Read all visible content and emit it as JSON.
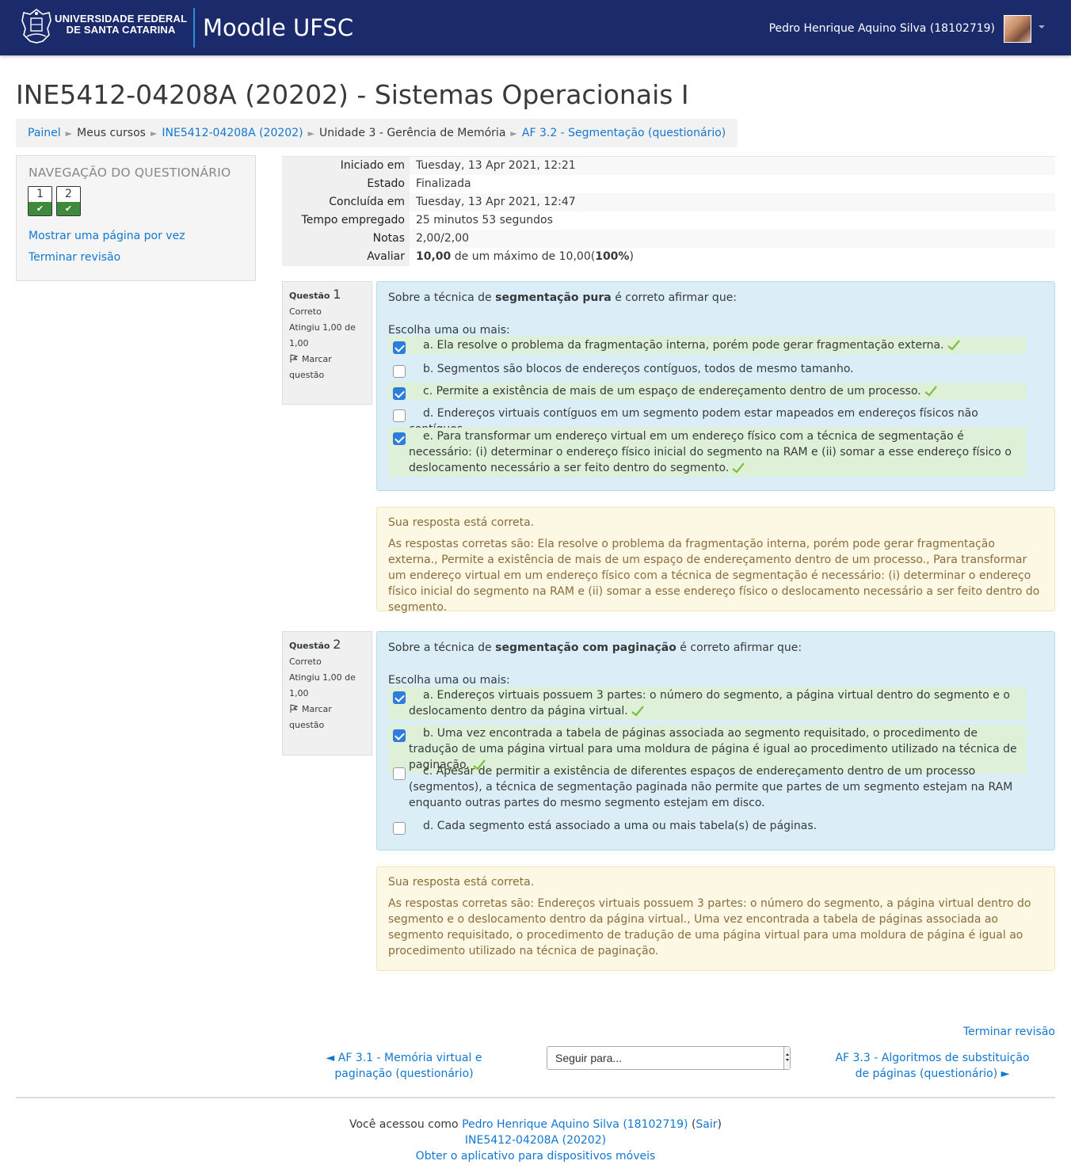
{
  "header": {
    "university_line1": "UNIVERSIDADE FEDERAL",
    "university_line2": "DE SANTA CATARINA",
    "site_name": "Moodle UFSC",
    "user_name": "Pedro Henrique Aquino Silva (18102719)"
  },
  "page": {
    "title": "INE5412-04208A (20202) - Sistemas Operacionais I"
  },
  "breadcrumb": [
    {
      "label": "Painel",
      "link": true
    },
    {
      "label": "Meus cursos",
      "link": false
    },
    {
      "label": "INE5412-04208A (20202)",
      "link": true
    },
    {
      "label": "Unidade 3 - Gerência de Memória",
      "link": false
    },
    {
      "label": "AF 3.2 - Segmentação (questionário)",
      "link": true
    }
  ],
  "quiz_nav": {
    "title": "NAVEGAÇÃO DO QUESTIONÁRIO",
    "buttons": [
      {
        "number": "1",
        "state": "correct"
      },
      {
        "number": "2",
        "state": "correct"
      }
    ],
    "show_one_page": "Mostrar uma página por vez",
    "finish_review": "Terminar revisão"
  },
  "summary": [
    {
      "label": "Iniciado em",
      "value": "Tuesday, 13 Apr 2021, 12:21"
    },
    {
      "label": "Estado",
      "value": "Finalizada"
    },
    {
      "label": "Concluída em",
      "value": "Tuesday, 13 Apr 2021, 12:47"
    },
    {
      "label": "Tempo empregado",
      "value": "25 minutos 53 segundos"
    },
    {
      "label": "Notas",
      "value": "2,00/2,00"
    },
    {
      "label": "Avaliar",
      "value_bold1": "10,00",
      "value_mid": " de um máximo de 10,00(",
      "value_bold2": "100%",
      "value_end": ")"
    }
  ],
  "questions": [
    {
      "label": "Questão",
      "number": "1",
      "status": "Correto",
      "grade": "Atingiu 1,00 de 1,00",
      "flag": "Marcar questão",
      "text_before": "Sobre a técnica de ",
      "text_bold": "segmentação pura",
      "text_after": " é correto afirmar que:",
      "prompt": "Escolha uma ou mais:",
      "options": [
        {
          "letter": "a.",
          "text": "Ela resolve o problema da fragmentação interna, porém pode gerar fragmentação externa.",
          "checked": true,
          "correct": true
        },
        {
          "letter": "b.",
          "text": "Segmentos são blocos de endereços contíguos, todos de mesmo tamanho.",
          "checked": false,
          "correct": false
        },
        {
          "letter": "c.",
          "text": "Permite a existência de mais de um espaço de endereçamento dentro de um processo.",
          "checked": true,
          "correct": true
        },
        {
          "letter": "d.",
          "text": "Endereços virtuais contíguos em um segmento podem estar mapeados em endereços físicos não contíguos.",
          "checked": false,
          "correct": false
        },
        {
          "letter": "e.",
          "text": "Para transformar um endereço virtual em um endereço físico com a técnica de segmentação é necessário: (i) determinar o endereço físico inicial do segmento na RAM e (ii) somar a esse endereço físico o deslocamento necessário a ser feito dentro do segmento.",
          "checked": true,
          "correct": true
        }
      ],
      "feedback_main": "Sua resposta está correta.",
      "feedback_right": "As respostas corretas são: Ela resolve o problema da fragmentação interna, porém pode gerar fragmentação externa., Permite a existência de mais de um espaço de endereçamento dentro de um processo., Para transformar um endereço virtual em um endereço físico com a técnica de segmentação é necessário: (i) determinar o endereço físico inicial do segmento na RAM e (ii) somar a esse endereço físico o deslocamento necessário a ser feito dentro do segmento."
    },
    {
      "label": "Questão",
      "number": "2",
      "status": "Correto",
      "grade": "Atingiu 1,00 de 1,00",
      "flag": "Marcar questão",
      "text_before": "Sobre a técnica de ",
      "text_bold": "segmentação com paginação",
      "text_after": " é correto afirmar que:",
      "prompt": "Escolha uma ou mais:",
      "options": [
        {
          "letter": "a.",
          "text": "Endereços virtuais possuem 3 partes: o número do segmento, a página virtual dentro do segmento e o deslocamento dentro da página virtual.",
          "checked": true,
          "correct": true
        },
        {
          "letter": "b.",
          "text": "Uma vez encontrada a tabela de páginas associada ao segmento requisitado, o procedimento de tradução de uma página virtual para uma moldura de página é igual ao procedimento utilizado na técnica de paginação.",
          "checked": true,
          "correct": true
        },
        {
          "letter": "c.",
          "text": "Apesar de permitir a existência de diferentes espaços de endereçamento dentro de um processo (segmentos), a técnica de segmentação paginada não permite que partes de um segmento estejam na RAM enquanto outras partes do mesmo segmento estejam em disco.",
          "checked": false,
          "correct": false
        },
        {
          "letter": "d.",
          "text": "Cada segmento está associado a uma ou mais tabela(s) de páginas.",
          "checked": false,
          "correct": false
        }
      ],
      "feedback_main": "Sua resposta está correta.",
      "feedback_right": "As respostas corretas são: Endereços virtuais possuem 3 partes: o número do segmento, a página virtual dentro do segmento e o deslocamento dentro da página virtual., Uma vez encontrada a tabela de páginas associada ao segmento requisitado, o procedimento de tradução de uma página virtual para uma moldura de página é igual ao procedimento utilizado na técnica de paginação."
    }
  ],
  "bottom_nav": {
    "finish_review": "Terminar revisão",
    "prev": "◄ AF 3.1 - Memória virtual e paginação (questionário)",
    "jump_placeholder": "Seguir para...",
    "next": "AF 3.3 - Algoritmos de substituição de páginas (questionário) ►"
  },
  "footer": {
    "logged_as": "Você acessou como ",
    "user_link": "Pedro Henrique Aquino Silva (18102719)",
    "open_paren": " (",
    "logout": "Sair",
    "close_paren": ")",
    "course_link": "INE5412-04208A (20202)",
    "app_link": "Obter o aplicativo para dispositivos móveis"
  },
  "colors": {
    "navbar": "#1b2a6b",
    "link": "#1177d1",
    "question_bg": "#dbeef7",
    "correct_bg": "#dff0d8",
    "feedback_bg": "#fcf8e3",
    "nav_correct": "#3f8a3e"
  }
}
